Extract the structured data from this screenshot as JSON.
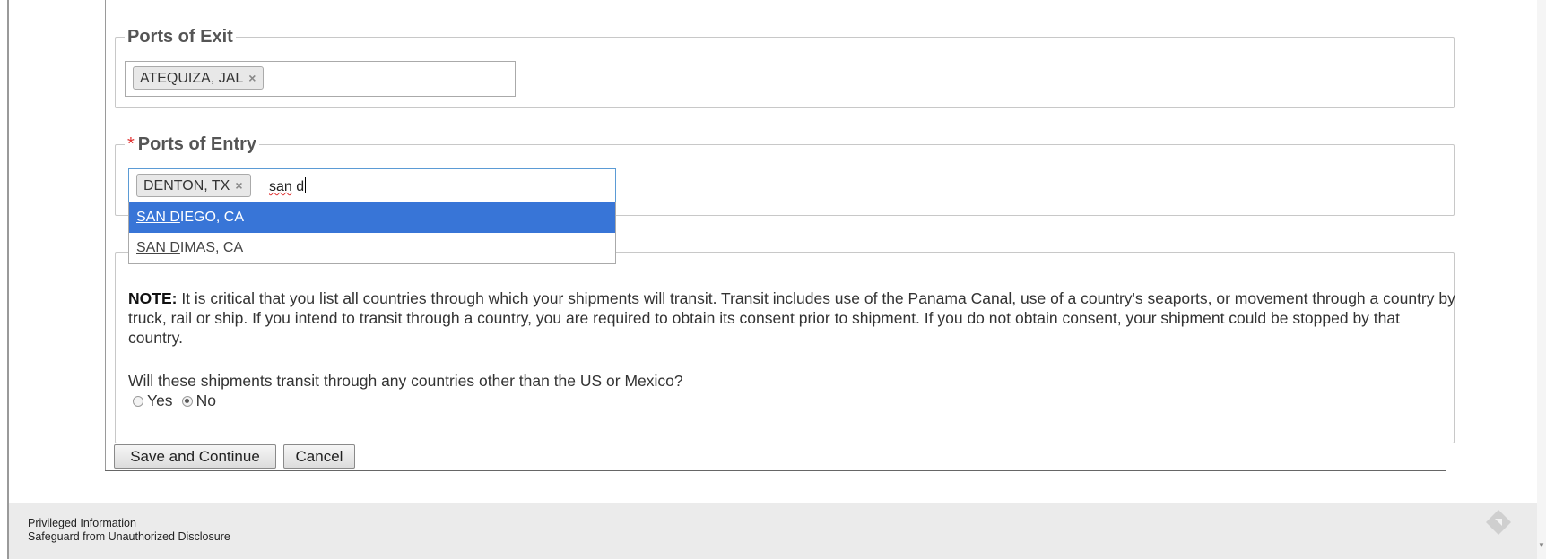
{
  "ports_of_exit": {
    "legend": "Ports of Exit",
    "tags": [
      {
        "label": "ATEQUIZA, JAL",
        "remove": "×"
      }
    ]
  },
  "ports_of_entry": {
    "required_mark": "*",
    "legend": "Ports of Entry",
    "tags": [
      {
        "label": "DENTON, TX",
        "remove": "×"
      }
    ],
    "typed_text": "san d",
    "typed_word": "san",
    "typed_rest": " d",
    "suggestions": [
      {
        "match": "SAN D",
        "rest": "IEGO, CA",
        "highlighted": true
      },
      {
        "match": "SAN D",
        "rest": "IMAS, CA",
        "highlighted": false
      }
    ]
  },
  "transit": {
    "note_label": "NOTE:",
    "note_text": " It is critical that you list all countries through which your shipments will transit. Transit includes use of the Panama Canal, use of a country's seaports, or movement through a country by truck, rail or ship. If you intend to transit through a country, you are required to obtain its consent prior to shipment. If you do not obtain consent, your shipment could be stopped by that country.",
    "question": "Will these shipments transit through any countries other than the US or Mexico?",
    "options": [
      {
        "label": "Yes",
        "checked": false
      },
      {
        "label": "No",
        "checked": true
      }
    ]
  },
  "buttons": {
    "save": "Save and Continue",
    "cancel": "Cancel"
  },
  "footer": {
    "line1": "Privileged Information",
    "line2": "Safeguard from Unauthorized Disclosure",
    "icon": "diamond-logo-icon"
  },
  "colors": {
    "highlight": "#3875d7",
    "required": "#e03030",
    "focus_border": "#5b9bd5"
  }
}
